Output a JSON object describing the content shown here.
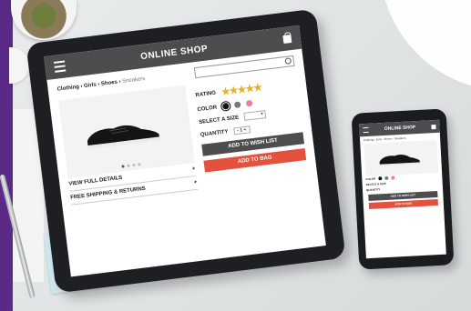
{
  "tablet": {
    "header": {
      "title": "ONLINE SHOP",
      "menu_icon": "hamburger-icon",
      "bag_icon": "shopping-bag-icon"
    },
    "breadcrumb": {
      "path": "Clothing › Girls › Shoes › ",
      "current": "Sneakers"
    },
    "search": {
      "placeholder": "",
      "icon": "search-icon"
    },
    "product": {
      "image": "black-sneaker",
      "carousel_dots": 4,
      "active_dot": 0
    },
    "accordion": [
      {
        "label": "VIEW FULL DETAILS",
        "symbol": "+"
      },
      {
        "label": "FREE SHIPPING & RETURNS",
        "symbol": "+"
      }
    ],
    "options": {
      "rating_label": "RATING",
      "rating_stars": "★★★★★",
      "rating_value": 4.5,
      "color_label": "COLOR",
      "color_swatches": [
        "#111111",
        "#777777",
        "#f07aa5"
      ],
      "size_label": "SELECT A SIZE",
      "size_value": "▾",
      "quantity_label": "QUANTITY",
      "quantity_value": "- 1 +"
    },
    "buttons": {
      "wishlist": "ADD TO WISH LIST",
      "bag": "ADD TO BAG"
    }
  },
  "phone": {
    "header": {
      "title": "ONLINE SHOP"
    },
    "breadcrumb": "Clothing › Girls › Shoes › Sneakers",
    "options": {
      "color_label": "COLOR",
      "size_label": "SELECT A SIZE",
      "quantity_label": "QUANTITY"
    },
    "buttons": {
      "wishlist": "ADD TO WISH LIST",
      "bag": "ADD TO BAG"
    }
  },
  "colors": {
    "header_gray": "#4d4d4f",
    "bag_button": "#e4513c",
    "star_gold": "#e2b42a",
    "brand_purple": "#5b2a86"
  }
}
